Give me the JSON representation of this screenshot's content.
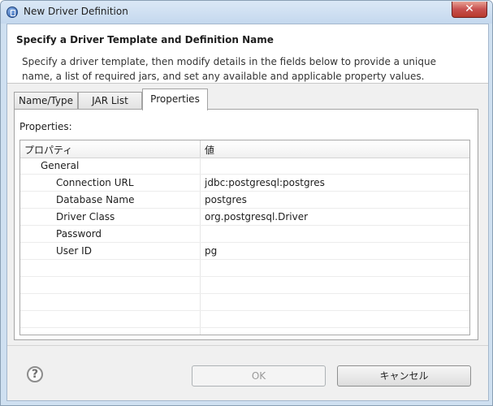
{
  "window": {
    "title": "New Driver Definition",
    "close_label": "✕"
  },
  "header": {
    "title": "Specify a Driver Template and Definition Name",
    "description": "Specify a driver template, then modify details in the fields below to provide a unique name, a list of required jars, and set any available and applicable property values."
  },
  "tabs": [
    {
      "label": "Name/Type",
      "active": false
    },
    {
      "label": "JAR List",
      "active": false
    },
    {
      "label": "Properties",
      "active": true
    }
  ],
  "properties_panel": {
    "label": "Properties:",
    "columns": [
      "プロパティ",
      "値"
    ],
    "rows": [
      {
        "name": "General",
        "value": "",
        "indent": 1
      },
      {
        "name": "Connection URL",
        "value": "jdbc:postgresql:postgres",
        "indent": 2
      },
      {
        "name": "Database Name",
        "value": "postgres",
        "indent": 2
      },
      {
        "name": "Driver Class",
        "value": "org.postgresql.Driver",
        "indent": 2
      },
      {
        "name": "Password",
        "value": "",
        "indent": 2
      },
      {
        "name": "User ID",
        "value": "pg",
        "indent": 2
      }
    ]
  },
  "buttons": {
    "help": "?",
    "ok": "OK",
    "cancel": "キャンセル"
  },
  "icons": {
    "app": "eclipse-app-icon",
    "help": "help-icon"
  }
}
